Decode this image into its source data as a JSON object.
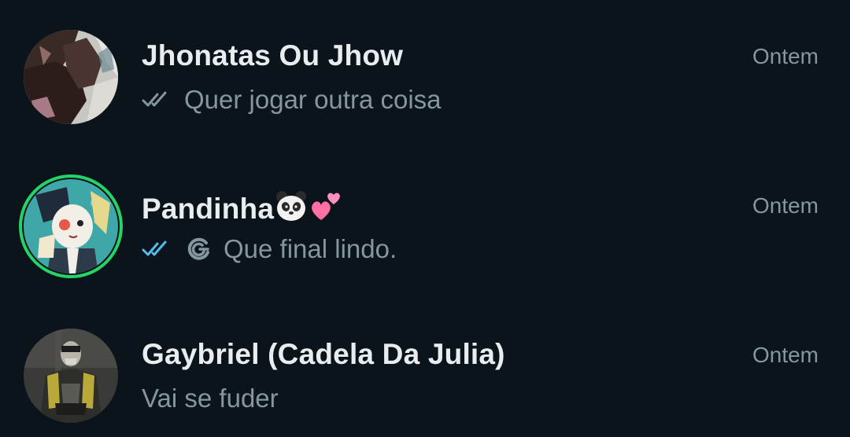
{
  "chats": [
    {
      "name": "Jhonatas Ou Jhow",
      "time": "Ontem",
      "preview": "Quer jogar outra coisa",
      "ticks": "double-check-grey",
      "avatar": "profile-photo"
    },
    {
      "name": "Pandinha",
      "name_emojis": [
        "panda-emoji",
        "two-hearts-emoji"
      ],
      "time": "Ontem",
      "preview": "Que final lindo.",
      "ticks": "double-check-blue",
      "extra_icon": "view-once-icon",
      "has_status": true,
      "avatar": "profile-photo"
    },
    {
      "name": "Gaybriel (Cadela Da Julia)",
      "time": "Ontem",
      "preview": "Vai se fuder",
      "avatar": "profile-photo"
    }
  ],
  "colors": {
    "background": "#0b141a",
    "primary_text": "#e9edef",
    "secondary_text": "#8696a0",
    "read_tick": "#53bdeb",
    "status_ring": "#25d366"
  }
}
